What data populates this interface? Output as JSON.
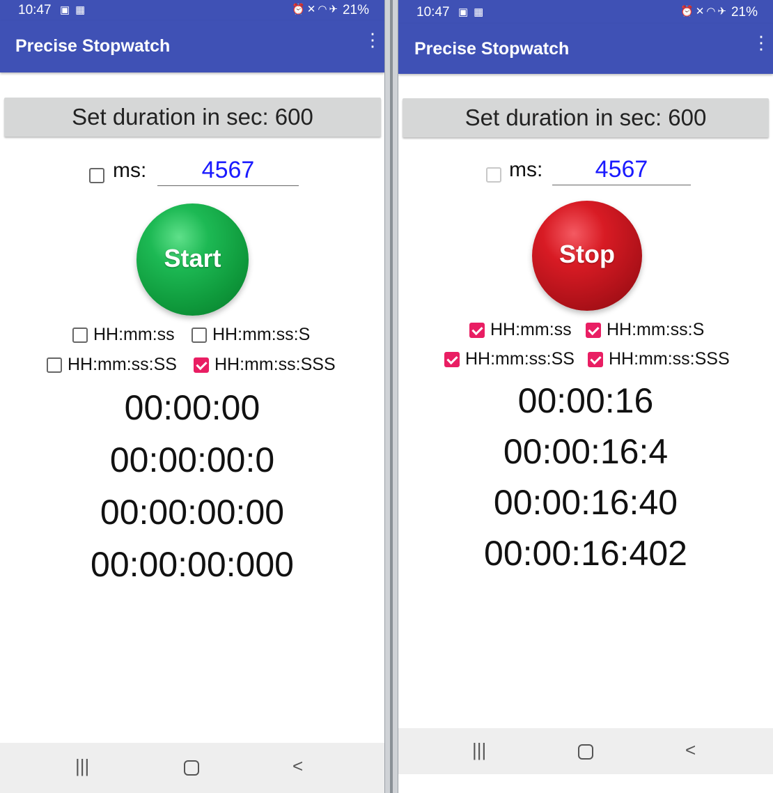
{
  "status_bar": {
    "time": "10:47",
    "battery": "21%"
  },
  "app": {
    "title": "Precise Stopwatch"
  },
  "icons": {
    "overflow_menu": "more-vert-icon",
    "nav_recents": "recents-icon",
    "nav_home": "home-icon",
    "nav_back": "back-icon"
  },
  "left": {
    "duration_button": "Set duration in sec: 600",
    "ms_label": "ms:",
    "ms_value": "4567",
    "ms_checked": false,
    "action_button": "Start",
    "formats": [
      {
        "label": "HH:mm:ss",
        "checked": false
      },
      {
        "label": "HH:mm:ss:S",
        "checked": false
      },
      {
        "label": "HH:mm:ss:SS",
        "checked": false
      },
      {
        "label": "HH:mm:ss:SSS",
        "checked": true
      }
    ],
    "times": [
      "00:00:00",
      "00:00:00:0",
      "00:00:00:00",
      "00:00:00:000"
    ]
  },
  "right": {
    "duration_button": "Set duration in sec: 600",
    "ms_label": "ms:",
    "ms_value": "4567",
    "ms_checked": false,
    "action_button": "Stop",
    "formats": [
      {
        "label": "HH:mm:ss",
        "checked": true
      },
      {
        "label": "HH:mm:ss:S",
        "checked": true
      },
      {
        "label": "HH:mm:ss:SS",
        "checked": true
      },
      {
        "label": "HH:mm:ss:SSS",
        "checked": true
      }
    ],
    "times": [
      "00:00:16",
      "00:00:16:4",
      "00:00:16:40",
      "00:00:16:402"
    ]
  },
  "colors": {
    "app_bar": "#3f51b5",
    "checkbox_checked": "#e91e63",
    "ms_text": "#1a1aff",
    "start_button": "#1db954",
    "stop_button": "#d81b24"
  }
}
